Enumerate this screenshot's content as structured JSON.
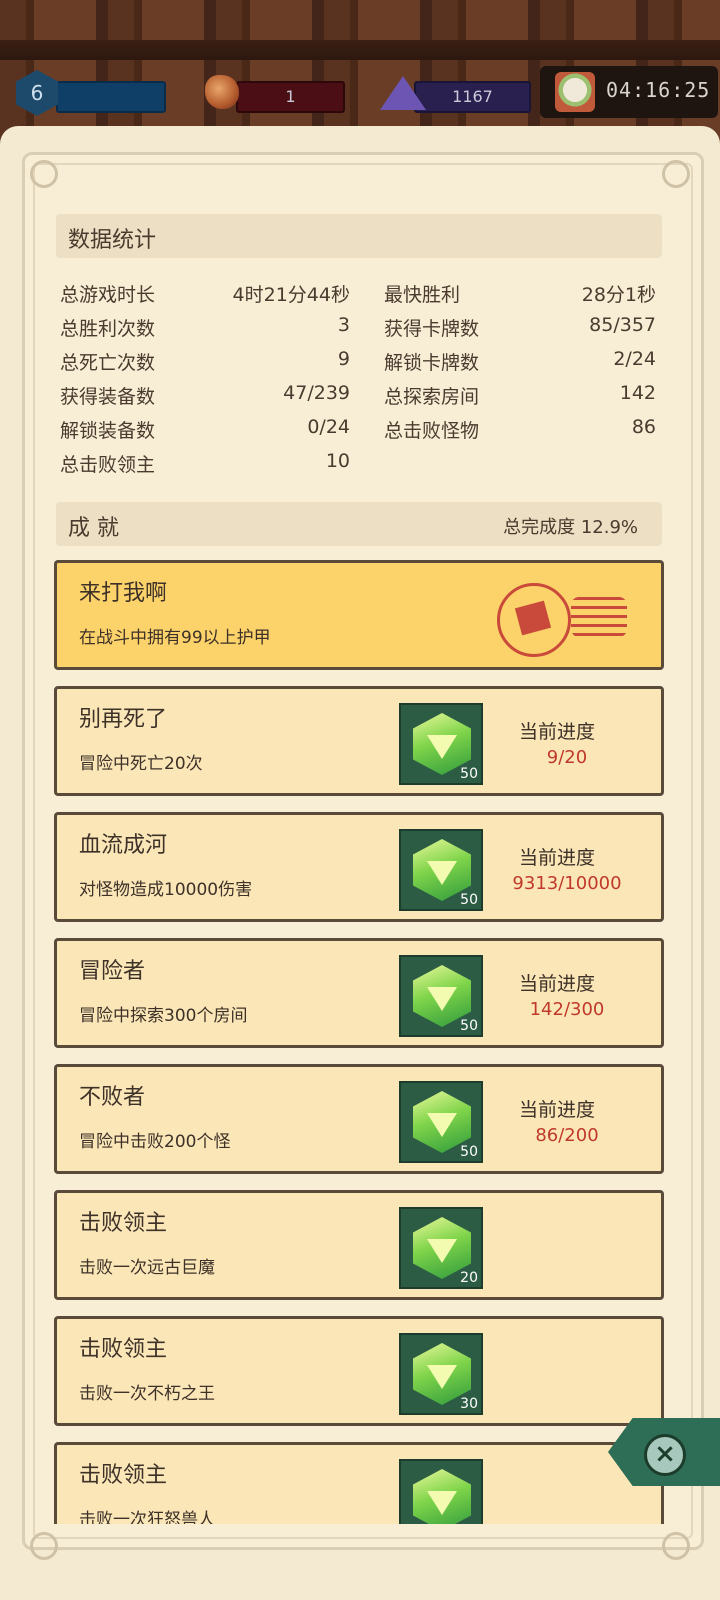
{
  "hud": {
    "level": "6",
    "gems": "1",
    "crystals": "1167",
    "time": "04:16:25"
  },
  "stats_section": {
    "title": "数据统计",
    "left": [
      {
        "label": "总游戏时长",
        "value": "4时21分44秒"
      },
      {
        "label": "总胜利次数",
        "value": "3"
      },
      {
        "label": "总死亡次数",
        "value": "9"
      },
      {
        "label": "获得装备数",
        "value": "47/239"
      },
      {
        "label": "解锁装备数",
        "value": "0/24"
      },
      {
        "label": "总击败领主",
        "value": "10"
      }
    ],
    "right": [
      {
        "label": "最快胜利",
        "value": "28分1秒"
      },
      {
        "label": "获得卡牌数",
        "value": "85/357"
      },
      {
        "label": "解锁卡牌数",
        "value": "2/24"
      },
      {
        "label": "总探索房间",
        "value": "142"
      },
      {
        "label": "总击败怪物",
        "value": "86"
      }
    ]
  },
  "achievements_section": {
    "title": "成 就",
    "completion": "总完成度  12.9%"
  },
  "progress_label": "当前进度",
  "achievements": [
    {
      "title": "来打我啊",
      "desc": "在战斗中拥有99以上护甲",
      "completed": true
    },
    {
      "title": "别再死了",
      "desc": "冒险中死亡20次",
      "reward": "50",
      "progress": "9/20"
    },
    {
      "title": "血流成河",
      "desc": "对怪物造成10000伤害",
      "reward": "50",
      "progress": "9313/10000"
    },
    {
      "title": "冒险者",
      "desc": "冒险中探索300个房间",
      "reward": "50",
      "progress": "142/300"
    },
    {
      "title": "不败者",
      "desc": "冒险中击败200个怪",
      "reward": "50",
      "progress": "86/200"
    },
    {
      "title": "击败领主",
      "desc": "击败一次远古巨魔",
      "reward": "20"
    },
    {
      "title": "击败领主",
      "desc": "击败一次不朽之王",
      "reward": "30"
    },
    {
      "title": "击败领主",
      "desc": "击败一次狂怒兽人",
      "reward": ""
    }
  ],
  "colors": {
    "parchment": "#f4ead2",
    "card": "#fbe6b8",
    "card_completed": "#fcd36a",
    "progress_red": "#c0392b",
    "reward_green": "#2d5c45"
  }
}
